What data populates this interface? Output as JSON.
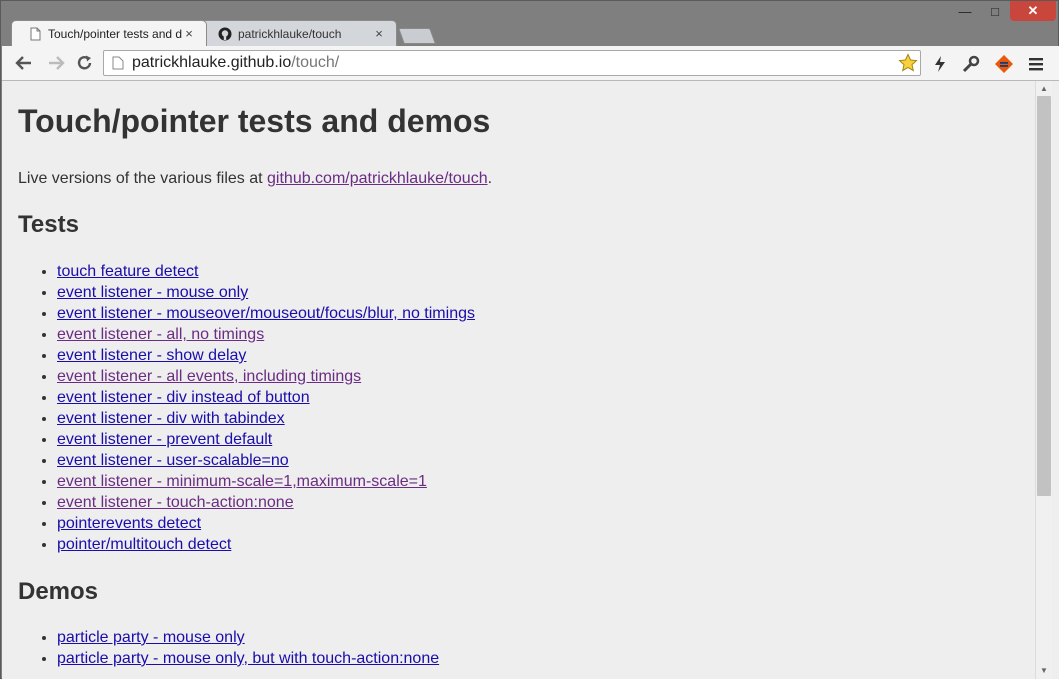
{
  "browser": {
    "tabs": [
      {
        "title": "Touch/pointer tests and d",
        "close": "×"
      },
      {
        "title": "patrickhlauke/touch",
        "close": "×"
      }
    ],
    "window_controls": {
      "minimize": "—",
      "maximize": "□",
      "close": "✕"
    },
    "address": {
      "host": "patrickhlauke.github.io",
      "path": "/touch/"
    }
  },
  "page": {
    "title": "Touch/pointer tests and demos",
    "intro_prefix": "Live versions of the various files at ",
    "intro_link": "github.com/patrickhlauke/touch",
    "intro_suffix": ".",
    "tests_heading": "Tests",
    "tests": [
      {
        "label": "touch feature detect",
        "visited": false
      },
      {
        "label": "event listener - mouse only",
        "visited": false
      },
      {
        "label": "event listener - mouseover/mouseout/focus/blur, no timings",
        "visited": false
      },
      {
        "label": "event listener - all, no timings",
        "visited": true
      },
      {
        "label": "event listener - show delay",
        "visited": false
      },
      {
        "label": "event listener - all events, including timings",
        "visited": true
      },
      {
        "label": "event listener - div instead of button",
        "visited": false
      },
      {
        "label": "event listener - div with tabindex",
        "visited": false
      },
      {
        "label": "event listener - prevent default",
        "visited": false
      },
      {
        "label": "event listener - user-scalable=no",
        "visited": false
      },
      {
        "label": "event listener - minimum-scale=1,maximum-scale=1",
        "visited": true
      },
      {
        "label": "event listener - touch-action:none",
        "visited": true
      },
      {
        "label": "pointerevents detect",
        "visited": false
      },
      {
        "label": "pointer/multitouch detect",
        "visited": false
      }
    ],
    "demos_heading": "Demos",
    "demos": [
      {
        "label": "particle party - mouse only",
        "visited": false
      },
      {
        "label": "particle party - mouse only, but with touch-action:none",
        "visited": false
      }
    ]
  },
  "colors": {
    "link": "#1a0dab",
    "visited_link": "#6b2c83",
    "page_bg": "#eeeeee",
    "close_button": "#c9463d"
  }
}
